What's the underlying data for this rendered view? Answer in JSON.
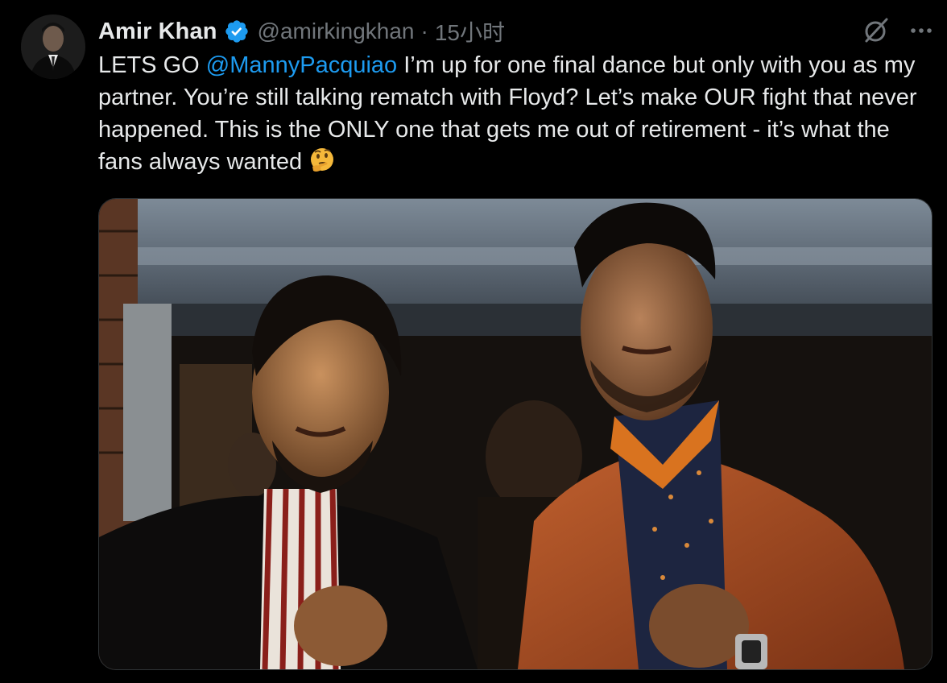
{
  "tweet": {
    "author": {
      "display_name": "Amir Khan",
      "handle": "@amirkingkhan",
      "verified": true,
      "verified_icon": "verified-badge-icon",
      "avatar_icon": "avatar"
    },
    "separator": "·",
    "timestamp": "15小时",
    "text": {
      "prefix": "LETS GO ",
      "mention": "@MannyPacquiao",
      "body": " I’m up for one final dance but only with you as my partner. You’re still talking rematch with Floyd? Let’s make OUR fight that never happened. This is the ONLY one that gets me out of retirement - it’s what the fans always wanted ",
      "emoji": "🤔"
    },
    "actions": {
      "grok_icon": "grok-icon",
      "more_icon": "more-icon"
    }
  },
  "colors": {
    "background": "#000000",
    "text_primary": "#e7e9ea",
    "text_secondary": "#71767b",
    "link": "#1d9bf0",
    "verified": "#1d9bf0",
    "border": "#2f3336"
  }
}
